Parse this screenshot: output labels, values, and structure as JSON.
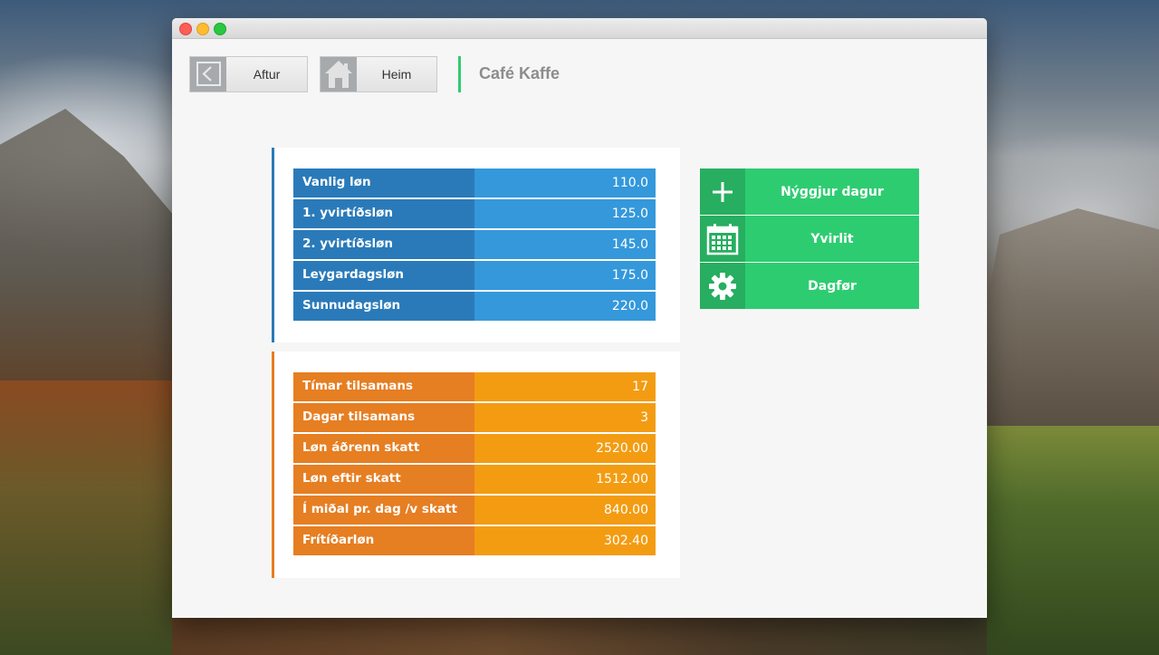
{
  "window": {
    "title": ""
  },
  "toolbar": {
    "back_label": "Aftur",
    "home_label": "Heim",
    "page_title": "Café Kaffe",
    "accent_color": "#2ecc71"
  },
  "rates": {
    "color_key": "#2a7ab9",
    "color_value": "#3498db",
    "rows": [
      {
        "label": "Vanlig løn",
        "value": "110.0"
      },
      {
        "label": "1. yvirtíðsløn",
        "value": "125.0"
      },
      {
        "label": "2. yvirtíðsløn",
        "value": "145.0"
      },
      {
        "label": "Leygardagsløn",
        "value": "175.0"
      },
      {
        "label": "Sunnudagsløn",
        "value": "220.0"
      }
    ]
  },
  "summary": {
    "color_key": "#e67e22",
    "color_value": "#f39c12",
    "rows": [
      {
        "label": "Tímar tilsamans",
        "value": "17"
      },
      {
        "label": "Dagar tilsamans",
        "value": "3"
      },
      {
        "label": "Løn áðrenn skatt",
        "value": "2520.00"
      },
      {
        "label": "Løn eftir skatt",
        "value": "1512.00"
      },
      {
        "label": "Í miðal pr. dag /v skatt",
        "value": "840.00"
      },
      {
        "label": "Frítíðarløn",
        "value": "302.40"
      }
    ]
  },
  "actions": [
    {
      "label": "Nýggjur dagur",
      "icon": "plus-icon"
    },
    {
      "label": "Yvirlit",
      "icon": "calendar-icon"
    },
    {
      "label": "Dagfør",
      "icon": "gear-icon"
    }
  ]
}
